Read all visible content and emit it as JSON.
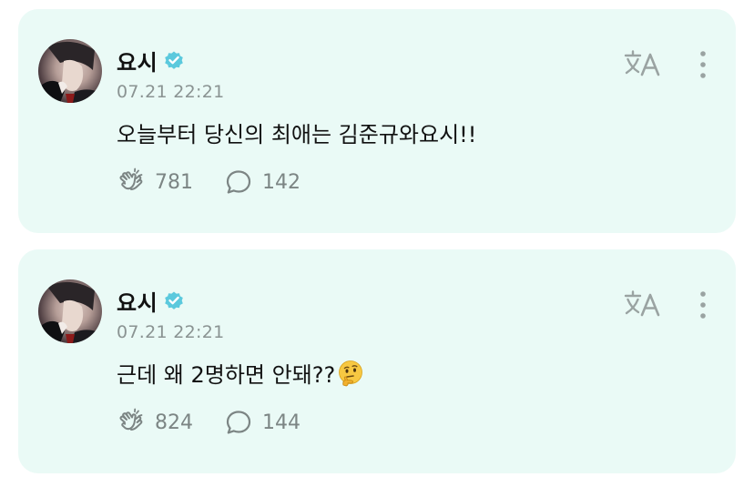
{
  "posts": [
    {
      "author": "요시",
      "timestamp": "07.21 22:21",
      "text": "오늘부터 당신의 최애는 김준규와요시!!",
      "emoji": "",
      "likes": "781",
      "comments": "142"
    },
    {
      "author": "요시",
      "timestamp": "07.21 22:21",
      "text": "근데 왜 2명하면 안돼??",
      "emoji": "thinking-face-emoji",
      "likes": "824",
      "comments": "144"
    }
  ],
  "colors": {
    "card_background": "#eafaf6",
    "verified_badge": "#5bc9dd",
    "secondary_text": "#8a9392"
  },
  "icons": {
    "verified": "verified-badge-icon",
    "translate": "translate-icon",
    "more": "more-vertical-icon",
    "likes": "clap-hands-icon",
    "comments": "speech-bubble-icon"
  }
}
